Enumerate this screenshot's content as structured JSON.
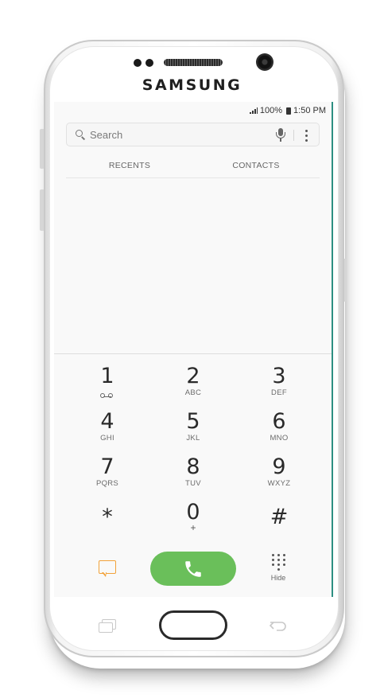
{
  "device": {
    "brand": "SAMSUNG"
  },
  "status_bar": {
    "battery": "100%",
    "time": "1:50 PM"
  },
  "search": {
    "placeholder": "Search"
  },
  "tabs": [
    {
      "label": "RECENTS"
    },
    {
      "label": "CONTACTS"
    }
  ],
  "keypad": [
    {
      "digit": "1",
      "letters": "",
      "icon": "voicemail-icon"
    },
    {
      "digit": "2",
      "letters": "ABC"
    },
    {
      "digit": "3",
      "letters": "DEF"
    },
    {
      "digit": "4",
      "letters": "GHI"
    },
    {
      "digit": "5",
      "letters": "JKL"
    },
    {
      "digit": "6",
      "letters": "MNO"
    },
    {
      "digit": "7",
      "letters": "PQRS"
    },
    {
      "digit": "8",
      "letters": "TUV"
    },
    {
      "digit": "9",
      "letters": "WXYZ"
    },
    {
      "digit": "*",
      "letters": ""
    },
    {
      "digit": "0",
      "letters": "+"
    },
    {
      "digit": "#",
      "letters": ""
    }
  ],
  "actions": {
    "hide_label": "Hide",
    "message_icon": "message-icon",
    "call_icon": "phone-icon"
  },
  "colors": {
    "call_button": "#6abf5a",
    "message_icon": "#f2a23a",
    "screen_background": "#f9f9f9"
  }
}
